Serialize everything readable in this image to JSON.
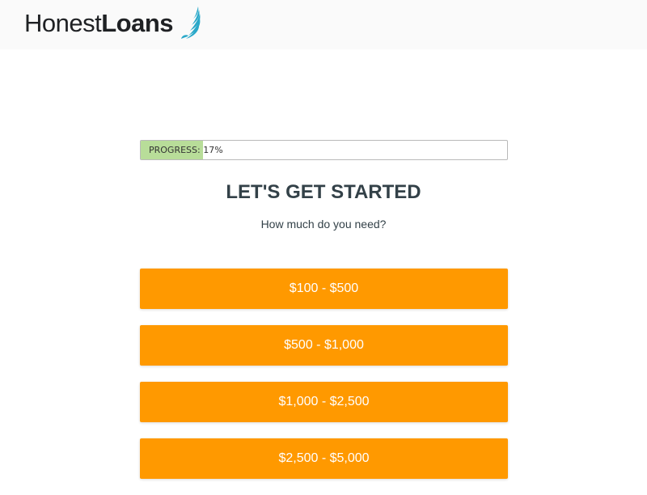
{
  "header": {
    "logo_light": "Honest",
    "logo_bold": "Loans"
  },
  "progress": {
    "label": "PROGRESS:",
    "value_text": "17%",
    "value": 17
  },
  "main": {
    "title": "LET'S GET STARTED",
    "subtitle": "How much do you need?"
  },
  "options": [
    {
      "label": "$100 - $500"
    },
    {
      "label": "$500 - $1,000"
    },
    {
      "label": "$1,000 - $2,500"
    },
    {
      "label": "$2,500 - $5,000"
    }
  ],
  "colors": {
    "accent": "#ff9900",
    "progress_fill": "#b8dd99",
    "logo_wing": "#29a8c9",
    "text": "#334148"
  }
}
